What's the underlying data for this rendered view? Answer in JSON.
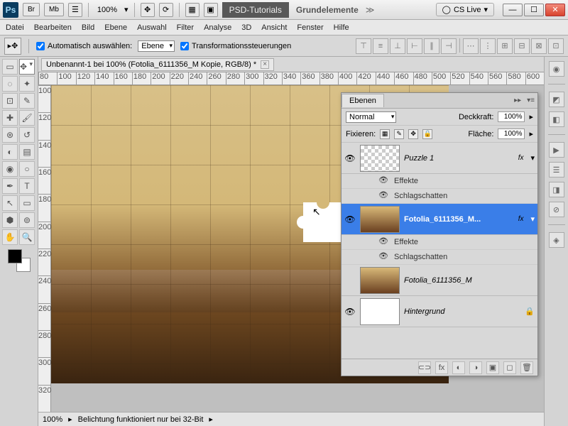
{
  "titlebar": {
    "br_btn": "Br",
    "mb_btn": "Mb",
    "zoom": "100%",
    "center_dark": "PSD-Tutorials",
    "center_light": "Grundelemente",
    "cslive": "CS Live"
  },
  "menu": [
    "Datei",
    "Bearbeiten",
    "Bild",
    "Ebene",
    "Auswahl",
    "Filter",
    "Analyse",
    "3D",
    "Ansicht",
    "Fenster",
    "Hilfe"
  ],
  "options": {
    "auto_select_label": "Automatisch auswählen:",
    "auto_select_value": "Ebene",
    "transform_label": "Transformationssteuerungen"
  },
  "doc": {
    "tab_title": "Unbenannt-1 bei 100% (Fotolia_6111356_M Kopie, RGB/8) *",
    "ruler_h": [
      "80",
      "100",
      "120",
      "140",
      "160",
      "180",
      "200",
      "220",
      "240",
      "260",
      "280",
      "300",
      "320",
      "340",
      "360",
      "380",
      "400",
      "420",
      "440",
      "460",
      "480",
      "500",
      "520",
      "540",
      "560",
      "580",
      "600"
    ],
    "ruler_v": [
      "100",
      "120",
      "140",
      "160",
      "180",
      "200",
      "220",
      "240",
      "260",
      "280",
      "300",
      "320"
    ],
    "status_zoom": "100%",
    "status_msg": "Belichtung funktioniert nur bei 32-Bit"
  },
  "layers": {
    "tab": "Ebenen",
    "blend_mode": "Normal",
    "opacity_label": "Deckkraft:",
    "opacity_value": "100%",
    "lock_label": "Fixieren:",
    "fill_label": "Fläche:",
    "fill_value": "100%",
    "effects_label": "Effekte",
    "dropshadow_label": "Schlagschatten",
    "items": [
      {
        "name": "Puzzle 1"
      },
      {
        "name": "Fotolia_6111356_M..."
      },
      {
        "name": "Fotolia_6111356_M"
      },
      {
        "name": "Hintergrund"
      }
    ],
    "fx_label": "fx"
  }
}
